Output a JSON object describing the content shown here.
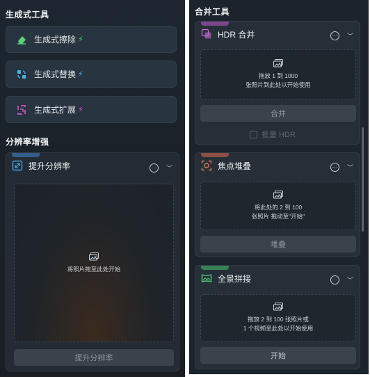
{
  "left": {
    "generative_title": "生成式工具",
    "tools": [
      {
        "label": "生成式擦除",
        "bolt": "⚡",
        "icon": "eraser-icon",
        "color": "#5ad17a"
      },
      {
        "label": "生成式替换",
        "bolt": "⚡",
        "icon": "replace-icon",
        "color": "#45b6e8"
      },
      {
        "label": "生成式扩展",
        "bolt": "⚡",
        "icon": "expand-icon",
        "color": "#e05bd3"
      }
    ],
    "resolution_title": "分辨率增强",
    "upscale": {
      "title": "提升分辨率",
      "drop_text": "将照片拖至此处开始",
      "action": "提升分辨率"
    }
  },
  "right": {
    "merge_title": "合并工具",
    "hdr": {
      "title": "HDR 合并",
      "drop_line1": "拖放 1 到 1000",
      "drop_line2": "张照片到此处以开始使用",
      "action": "合并",
      "batch": "批量 HDR"
    },
    "focus": {
      "title": "焦点堆叠",
      "drop_line1": "将此处的 2 到 100",
      "drop_line2": "张照片 拖动至\"开始\"",
      "action": "堆叠"
    },
    "pano": {
      "title": "全景拼接",
      "drop_line1": "拖放 2 到 100 张照片或",
      "drop_line2": "1 个视频至此处以开始使用",
      "action": "开始"
    }
  }
}
